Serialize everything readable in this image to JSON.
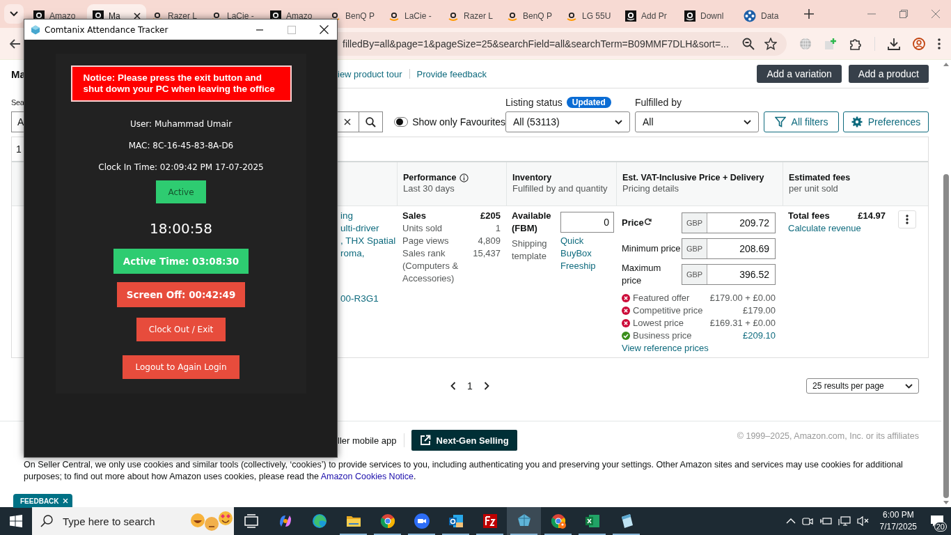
{
  "browser": {
    "tabs": [
      {
        "title": "Amazo",
        "kind": "amazon-dark",
        "selected": false
      },
      {
        "title": "Ma",
        "kind": "amazon-dark",
        "selected": true
      },
      {
        "title": "Razer L",
        "kind": "amazon-light",
        "selected": false
      },
      {
        "title": "LaCie -",
        "kind": "amazon-light",
        "selected": false
      },
      {
        "title": "Amazo",
        "kind": "amazon-dark",
        "selected": false
      },
      {
        "title": "BenQ P",
        "kind": "amazon-light",
        "selected": false
      },
      {
        "title": "LaCie -",
        "kind": "amazon-light",
        "selected": false
      },
      {
        "title": "Razer L",
        "kind": "amazon-light",
        "selected": false
      },
      {
        "title": "BenQ P",
        "kind": "amazon-light",
        "selected": false
      },
      {
        "title": "LG 55U",
        "kind": "amazon-light",
        "selected": false
      },
      {
        "title": "Add Pr",
        "kind": "amazon-dark",
        "selected": false
      },
      {
        "title": "Downl",
        "kind": "amazon-dark",
        "selected": false
      },
      {
        "title": "Data",
        "kind": "data",
        "selected": false
      }
    ],
    "url": "filledBy=all&page=1&pageSize=25&searchField=all&searchTerm=B09MMF7DLH&sort=..."
  },
  "page": {
    "header_fragment": "Ma",
    "links": [
      "iew product tour",
      "Provide feedback"
    ],
    "buttons": [
      "Add a variation",
      "Add a product"
    ],
    "search_label_fragment": "Sea",
    "search_value_fragment": "A",
    "favourites_toggle": {
      "label": "Show only Favourites",
      "on": false
    },
    "listing_status": {
      "label": "Listing status",
      "badge": "Updated",
      "value": "All (53113)"
    },
    "fulfilled_by": {
      "label": "Fulfilled by",
      "value": "All"
    },
    "filter_buttons": [
      {
        "label": "All filters",
        "kind": "filter"
      },
      {
        "label": "Preferences",
        "kind": "settings"
      }
    ],
    "results_fragment": "1",
    "table": {
      "columns": [
        {
          "title": "Performance",
          "subtitle": "Last 30 days",
          "info": true
        },
        {
          "title": "Inventory",
          "subtitle": "Fulfilled by and quantity",
          "info": false
        },
        {
          "title": "Est. VAT-Inclusive Price + Delivery",
          "subtitle": "Pricing details",
          "info": false
        },
        {
          "title": "Estimated fees",
          "subtitle": "per unit sold",
          "info": false
        }
      ],
      "row": {
        "product_lines": [
          "ing",
          "ulti-driver",
          ", THX Spatial",
          "roma,"
        ],
        "sku_fragment": "00-R3G1",
        "performance": {
          "heading": "Sales",
          "heading_value": "£205",
          "rows": [
            {
              "label": "Units sold",
              "value": "1"
            },
            {
              "label": "Page views",
              "value": "4,809"
            },
            {
              "label": "Sales rank (Computers & Accessories)",
              "value": "15,437"
            }
          ]
        },
        "inventory": {
          "label": "Available (FBM)",
          "quantity": "0",
          "shipping_label": "Shipping template",
          "shipping_value": "Quick BuyBox Freeship"
        },
        "pricing": {
          "fields": [
            {
              "label": "Price",
              "refresh": true,
              "currency": "GBP",
              "value": "209.72"
            },
            {
              "label": "Minimum price",
              "refresh": false,
              "currency": "GBP",
              "value": "208.69"
            },
            {
              "label": "Maximum price",
              "refresh": false,
              "currency": "GBP",
              "value": "396.52"
            }
          ],
          "references": [
            {
              "label": "Featured offer",
              "value": "£179.00 + £0.00",
              "met": false
            },
            {
              "label": "Competitive price",
              "value": "£179.00",
              "met": false
            },
            {
              "label": "Lowest price",
              "value": "£169.31 + £0.00",
              "met": false
            },
            {
              "label": "Business price",
              "value": "£209.10",
              "met": true
            }
          ],
          "link": "View reference prices"
        },
        "fees": {
          "label": "Total fees",
          "value": "£14.97",
          "link": "Calculate revenue"
        }
      }
    },
    "pagination": {
      "page": "1",
      "per_page": "25 results per page"
    },
    "footer": {
      "app_text": "ller mobile app",
      "button": "Next-Gen Selling",
      "copyright": "© 1999–2025, Amazon.com, Inc. or its affiliates"
    },
    "cookie_notice": {
      "text": "On Seller Central, we only use cookies and similar tools (collectively, ‘cookies’) to provide services to you, including authenticating you and preserving your settings. Other Amazon sites and services may use cookies for additional purposes; to find out more about how Amazon uses cookies, please read the ",
      "link": "Amazon Cookies Notice",
      "after": "."
    },
    "feedback": "FEEDBACK"
  },
  "app_window": {
    "title": "Comtanix Attendance Tracker",
    "notice": "Notice: Please press the exit button and shut down your PC when leaving the office",
    "info": [
      "User: Muhammad Umair",
      "MAC: 8C-16-45-83-8A-D6",
      "Clock In Time: 02:09:42 PM 17-07-2025"
    ],
    "status": {
      "label": "Active",
      "color": "#2ecc71"
    },
    "clock": "18:00:58",
    "buttons": [
      {
        "label": "Active Time: 03:08:30",
        "kind": "timer",
        "color": "#2ecc71"
      },
      {
        "label": "Screen Off: 00:42:49",
        "kind": "timer",
        "color": "#e74c3c"
      },
      {
        "label": "Clock Out / Exit",
        "kind": "action",
        "color": "#e74c3c"
      },
      {
        "label": "Logout to Again Login",
        "kind": "action",
        "color": "#e74c3c"
      }
    ]
  },
  "taskbar": {
    "search_placeholder": "Type here to search",
    "apps": [
      {
        "kind": "task-view",
        "open": false,
        "selected": false
      },
      {
        "kind": "copilot",
        "open": false,
        "selected": false
      },
      {
        "kind": "edge",
        "open": false,
        "selected": false
      },
      {
        "kind": "explorer",
        "open": true,
        "selected": false
      },
      {
        "kind": "chrome",
        "open": true,
        "selected": false
      },
      {
        "kind": "zoom",
        "open": true,
        "selected": false
      },
      {
        "kind": "outlook",
        "open": true,
        "selected": false
      },
      {
        "kind": "filezilla",
        "open": true,
        "selected": false
      },
      {
        "kind": "tracker",
        "open": true,
        "selected": true
      },
      {
        "kind": "chrome-profile",
        "open": true,
        "selected": false
      },
      {
        "kind": "excel",
        "open": true,
        "selected": false
      },
      {
        "kind": "notepad",
        "open": true,
        "selected": false
      }
    ],
    "time": "6:00 PM",
    "date": "7/17/2025",
    "notifications": "20"
  }
}
